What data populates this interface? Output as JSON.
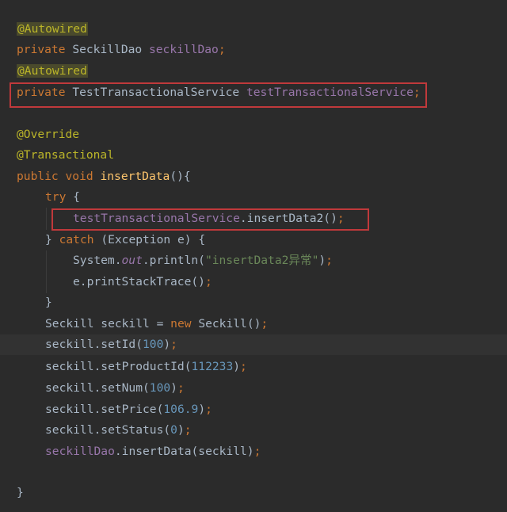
{
  "editor": {
    "colors": {
      "background": "#2b2b2b",
      "annotation": "#bbb529",
      "keyword": "#cc7832",
      "field": "#9876aa",
      "method_decl": "#ffc66d",
      "number": "#6897bb",
      "string": "#6a8759",
      "default_text": "#a9b7c6",
      "highlight_box": "#c0393b"
    },
    "lines": {
      "l1": {
        "ann": "@Autowired"
      },
      "l2": {
        "kw": "private",
        "type": "SeckillDao",
        "field": "seckillDao",
        "semi": ";"
      },
      "l3": {
        "ann": "@Autowired"
      },
      "l4": {
        "kw": "private",
        "type": "TestTransactionalService",
        "field": "testTransactionalService",
        "semi": ";"
      },
      "l6": {
        "ann": "@Override"
      },
      "l7": {
        "ann": "@Transactional"
      },
      "l8": {
        "kw1": "public",
        "kw2": "void",
        "method": "insertData",
        "rest": "(){"
      },
      "l9": {
        "kw": "try",
        "rest": "{"
      },
      "l10": {
        "field": "testTransactionalService",
        "call": ".insertData2()",
        "semi": ";"
      },
      "l11": {
        "brace": "}",
        "kw": "catch",
        "rest": "(Exception e) {"
      },
      "l12": {
        "cls": "System.",
        "static": "out",
        "call": ".println(",
        "str": "\"insertData2异常\"",
        "close": ")",
        "semi": ";"
      },
      "l13": {
        "call": "e.printStackTrace()",
        "semi": ";"
      },
      "l14": {
        "brace": "}"
      },
      "l15": {
        "decl": "Seckill seckill = ",
        "kw": "new",
        "ctor": "Seckill()",
        "semi": ";"
      },
      "l16": {
        "call": "seckill.setId(",
        "num": "100",
        "close": ")",
        "semi": ";"
      },
      "l17": {
        "call": "seckill.setProductId(",
        "num": "112233",
        "close": ")",
        "semi": ";"
      },
      "l18": {
        "call": "seckill.setNum(",
        "num": "100",
        "close": ")",
        "semi": ";"
      },
      "l19": {
        "call": "seckill.setPrice(",
        "num": "106.9",
        "close": ")",
        "semi": ";"
      },
      "l20": {
        "call": "seckill.setStatus(",
        "num": "0",
        "close": ")",
        "semi": ";"
      },
      "l21": {
        "field": "seckillDao",
        "call": ".insertData(seckill)",
        "semi": ";"
      },
      "l23": {
        "brace": "}"
      }
    }
  }
}
